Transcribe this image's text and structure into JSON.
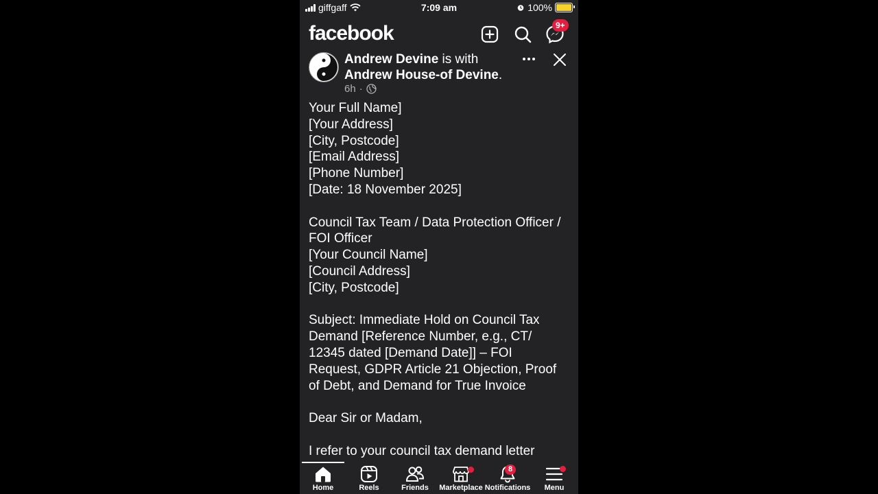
{
  "status_bar": {
    "carrier": "giffgaff",
    "time": "7:09 am",
    "battery": "100%"
  },
  "header": {
    "logo": "facebook",
    "messenger_badge": "9+"
  },
  "post": {
    "author": "Andrew Devine",
    "with_text": " is with",
    "tagged": "Andrew House-of Devine",
    "tagged_suffix": ".",
    "time": "6h",
    "separator": "·",
    "lines": [
      "Your Full Name]",
      "[Your Address]",
      "[City, Postcode]",
      "[Email Address]",
      "[Phone Number]",
      "[Date: 18 November 2025]",
      "",
      "Council Tax Team / Data Protection Officer /",
      "FOI Officer",
      "[Your Council Name]",
      "[Council Address]",
      "[City, Postcode]",
      "",
      "Subject: Immediate Hold on Council Tax",
      "Demand [Reference Number, e.g., CT/",
      "12345 dated [Demand Date]] – FOI",
      "Request, GDPR Article 21 Objection, Proof",
      "of Debt, and Demand for True Invoice",
      "",
      "Dear Sir or Madam,",
      "",
      "I refer to your council tax demand letter"
    ]
  },
  "tabs": [
    {
      "label": "Home",
      "icon": "home-icon"
    },
    {
      "label": "Reels",
      "icon": "reels-icon"
    },
    {
      "label": "Friends",
      "icon": "friends-icon"
    },
    {
      "label": "Marketplace",
      "icon": "marketplace-icon"
    },
    {
      "label": "Notifications",
      "icon": "bell-icon",
      "badge": "8"
    },
    {
      "label": "Menu",
      "icon": "menu-icon"
    }
  ],
  "colors": {
    "background": "#232325",
    "badge": "#e41e3f",
    "battery": "#f7d22e"
  }
}
